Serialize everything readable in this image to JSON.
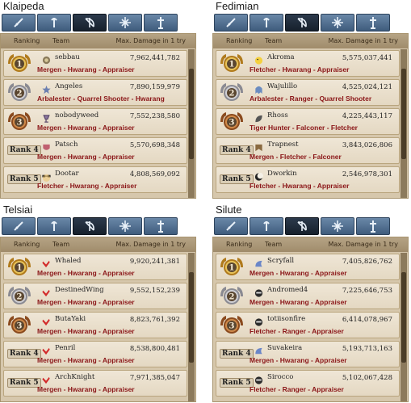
{
  "columns": {
    "ranking": "Ranking",
    "team": "Team",
    "damage": "Max. Damage in 1 try"
  },
  "tabs": [
    "sword-tab",
    "staff-tab",
    "bow-tab",
    "cross-tab",
    "cleric-tab"
  ],
  "colors": {
    "tab_blue": "#4f6d8f",
    "tab_dark": "#1c2633",
    "board": "#d6c7ac",
    "class_text": "#8b1618"
  },
  "servers": [
    {
      "name": "Klaipeda",
      "rows": [
        {
          "rank": "1",
          "rank_label": "",
          "player": "sebbau",
          "damage": "7,962,441,782",
          "classes": "Mergen - Hwarang - Appraiser",
          "avatar": "crest"
        },
        {
          "rank": "2",
          "rank_label": "",
          "player": "Angeles",
          "damage": "7,890,159,979",
          "classes": "Arbalester - Quarrel Shooter - Hwarang",
          "avatar": "star"
        },
        {
          "rank": "3",
          "rank_label": "",
          "player": "nobodyweed",
          "damage": "7,552,238,580",
          "classes": "Mergen - Hwarang - Appraiser",
          "avatar": "chalice"
        },
        {
          "rank": "4",
          "rank_label": "Rank 4",
          "player": "Patsch",
          "damage": "5,570,698,348",
          "classes": "Mergen - Hwarang - Appraiser",
          "avatar": "shield"
        },
        {
          "rank": "5",
          "rank_label": "Rank 5",
          "player": "Dootar",
          "damage": "4,808,569,092",
          "classes": "Fletcher - Hwarang - Appraiser",
          "avatar": "glasses"
        }
      ]
    },
    {
      "name": "Fedimian",
      "rows": [
        {
          "rank": "1",
          "rank_label": "",
          "player": "Akroma",
          "damage": "5,575,037,441",
          "classes": "Fletcher - Hwarang - Appraiser",
          "avatar": "chick"
        },
        {
          "rank": "2",
          "rank_label": "",
          "player": "Wajulillo",
          "damage": "4,525,024,121",
          "classes": "Arbalester - Ranger - Quarrel Shooter",
          "avatar": "ghost"
        },
        {
          "rank": "3",
          "rank_label": "",
          "player": "Rhoss",
          "damage": "4,225,443,117",
          "classes": "Tiger Hunter - Falconer - Fletcher",
          "avatar": "leaf"
        },
        {
          "rank": "4",
          "rank_label": "Rank 4",
          "player": "Trapnest",
          "damage": "3,843,026,806",
          "classes": "Mergen - Fletcher - Falconer",
          "avatar": "banner"
        },
        {
          "rank": "5",
          "rank_label": "Rank 5",
          "player": "Dworkin",
          "damage": "2,546,978,301",
          "classes": "Fletcher - Hwarang - Appraiser",
          "avatar": "moon"
        }
      ]
    },
    {
      "name": "Telsiai",
      "rows": [
        {
          "rank": "1",
          "rank_label": "",
          "player": "Whaled",
          "damage": "9,920,241,381",
          "classes": "Mergen - Hwarang - Appraiser",
          "avatar": "redmark"
        },
        {
          "rank": "2",
          "rank_label": "",
          "player": "DestinedWing",
          "damage": "9,552,152,239",
          "classes": "Mergen - Hwarang - Appraiser",
          "avatar": "redmark"
        },
        {
          "rank": "3",
          "rank_label": "",
          "player": "ButaYaki",
          "damage": "8,823,761,392",
          "classes": "Mergen - Hwarang - Appraiser",
          "avatar": "redmark"
        },
        {
          "rank": "4",
          "rank_label": "Rank 4",
          "player": "Penril",
          "damage": "8,538,800,481",
          "classes": "Mergen - Hwarang - Appraiser",
          "avatar": "redmark"
        },
        {
          "rank": "5",
          "rank_label": "Rank 5",
          "player": "ArchKnight",
          "damage": "7,971,385,047",
          "classes": "Mergen - Hwarang - Appraiser",
          "avatar": "redmark"
        }
      ]
    },
    {
      "name": "Silute",
      "rows": [
        {
          "rank": "1",
          "rank_label": "",
          "player": "Scryfall",
          "damage": "7,405,826,762",
          "classes": "Mergen - Hwarang - Appraiser",
          "avatar": "wing"
        },
        {
          "rank": "2",
          "rank_label": "",
          "player": "Andromed4",
          "damage": "7,225,646,753",
          "classes": "Mergen - Hwarang - Appraiser",
          "avatar": "helm"
        },
        {
          "rank": "3",
          "rank_label": "",
          "player": "totiisonfire",
          "damage": "6,414,078,967",
          "classes": "Fletcher - Ranger - Appraiser",
          "avatar": "helm"
        },
        {
          "rank": "4",
          "rank_label": "Rank 4",
          "player": "Suvakeira",
          "damage": "5,193,713,163",
          "classes": "Mergen - Hwarang - Appraiser",
          "avatar": "wing"
        },
        {
          "rank": "5",
          "rank_label": "Rank 5",
          "player": "Sirocco",
          "damage": "5,102,067,428",
          "classes": "Fletcher - Ranger - Appraiser",
          "avatar": "helm"
        }
      ]
    }
  ]
}
